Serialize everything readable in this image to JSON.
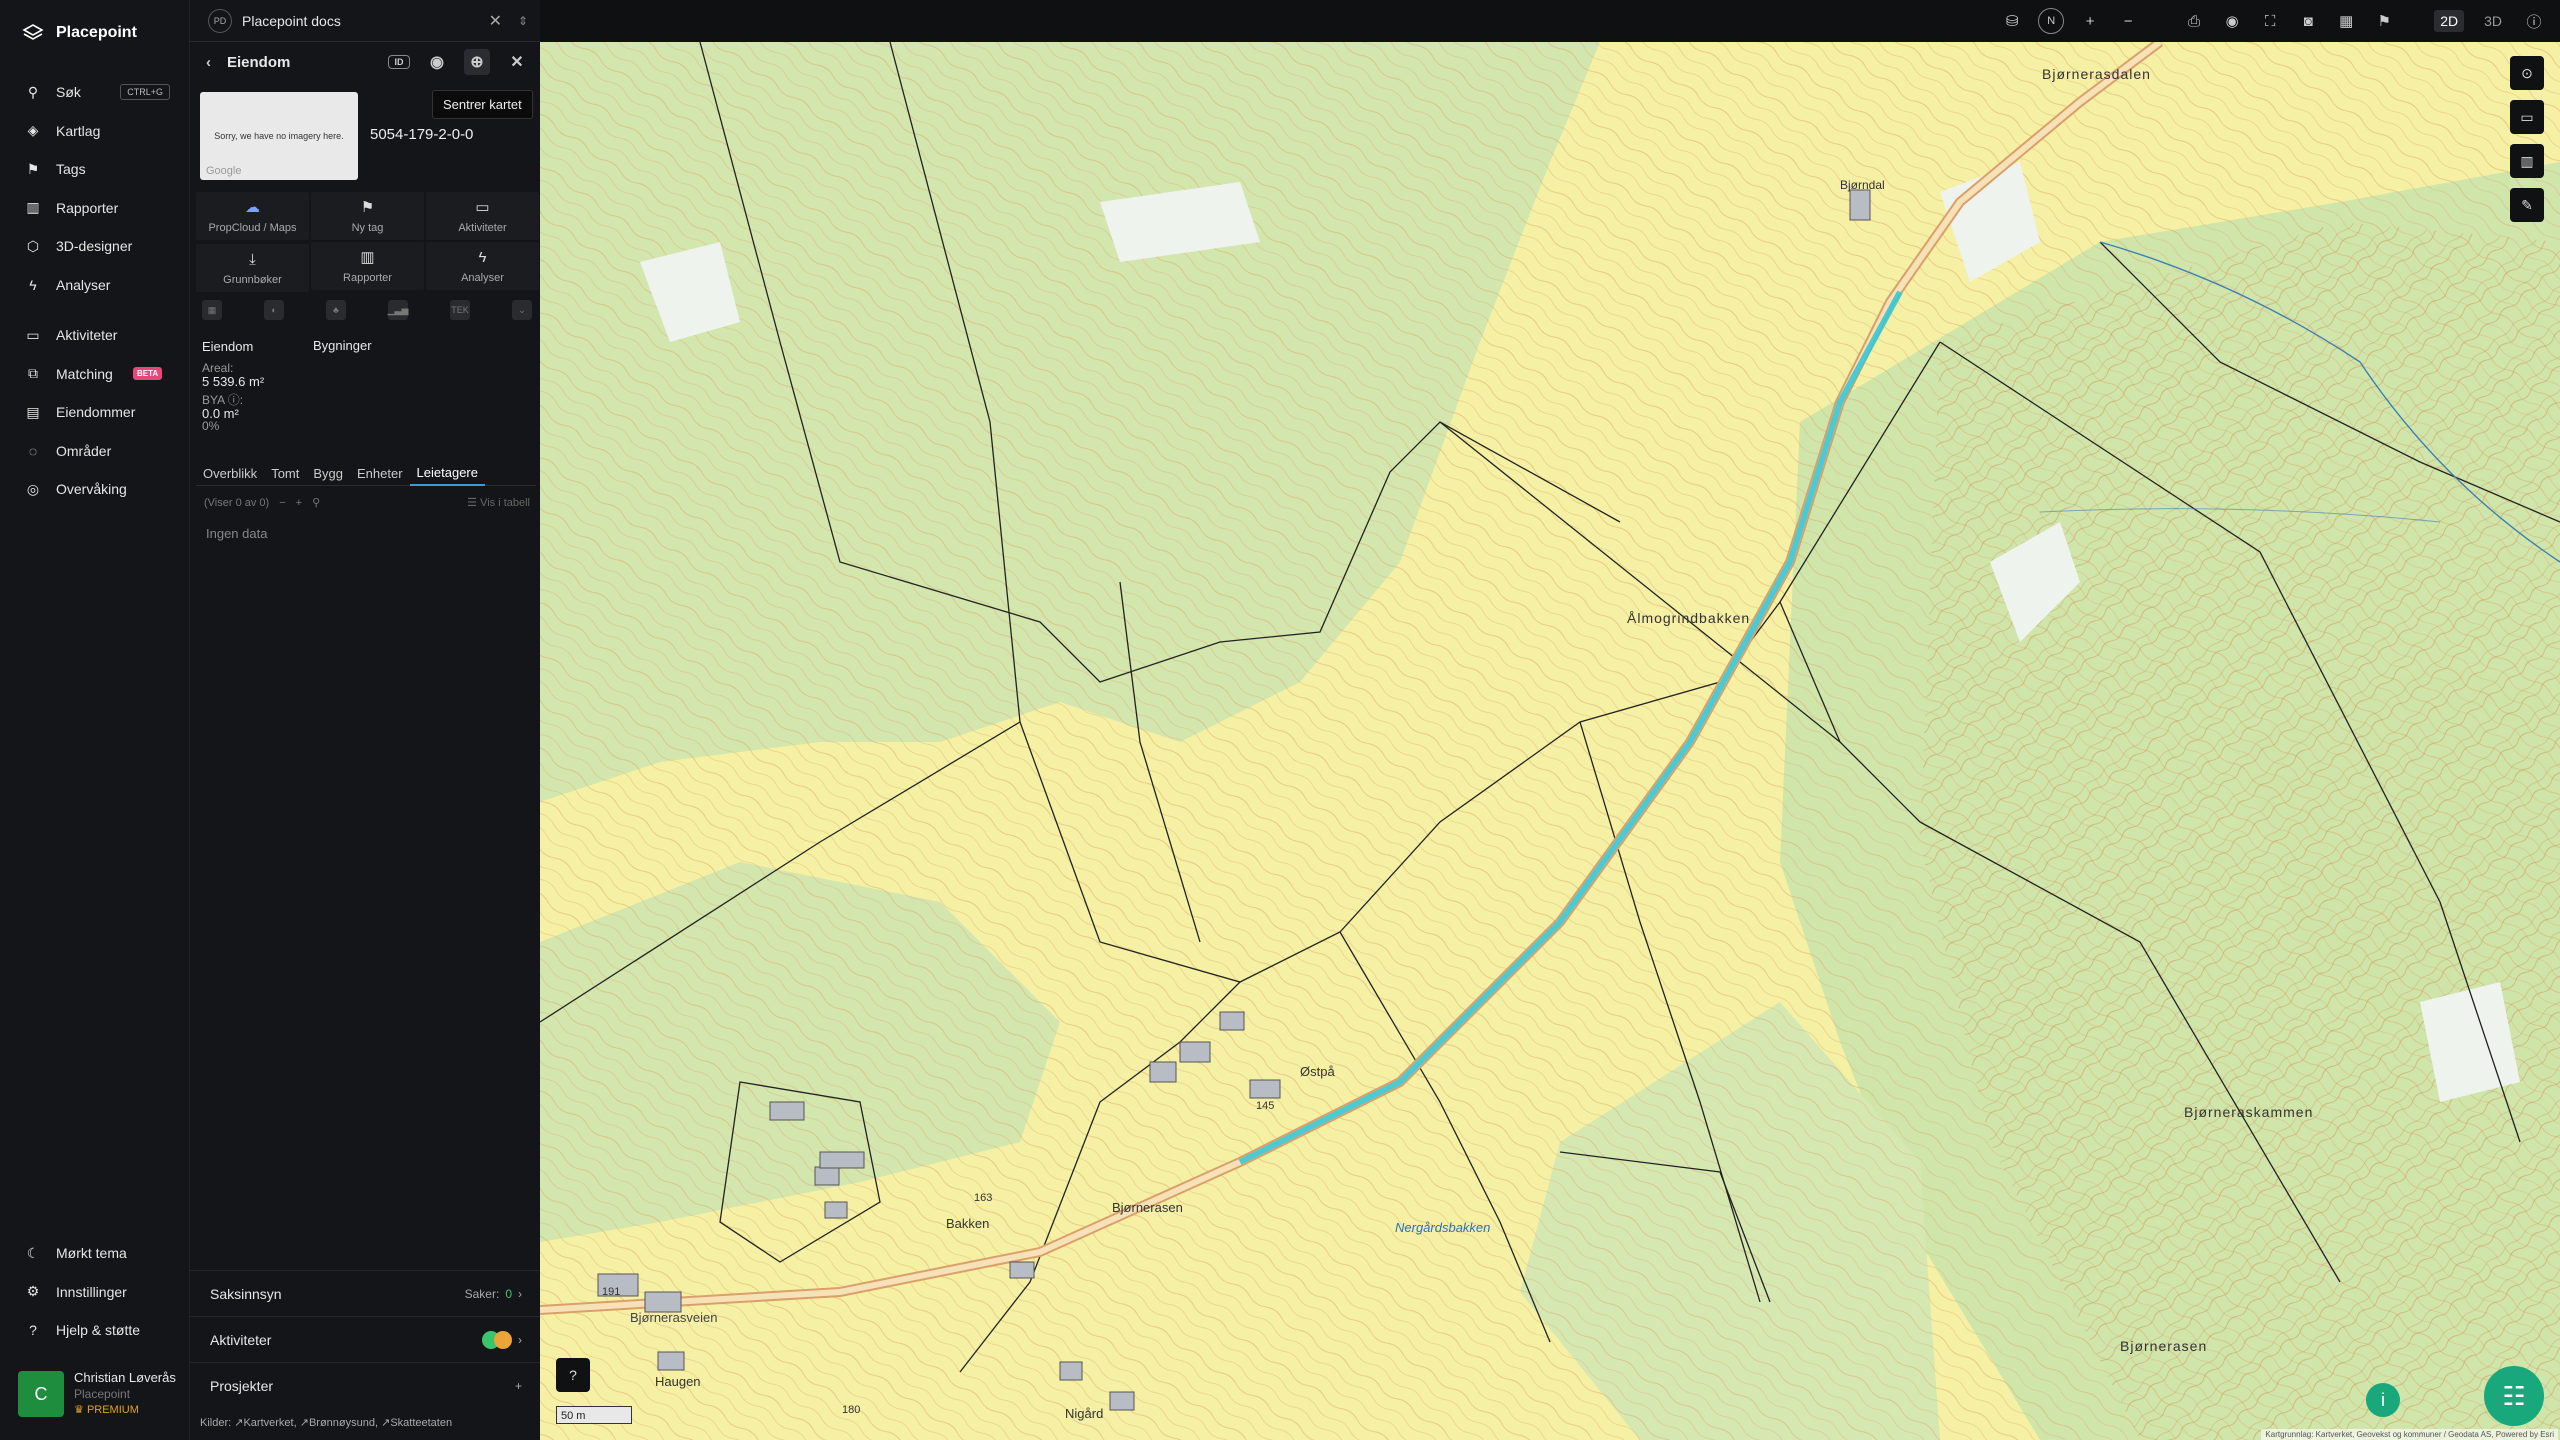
{
  "nav": {
    "brand": "Placepoint",
    "items": [
      {
        "label": "Søk",
        "icon": "search-icon",
        "kbd": "CTRL+G"
      },
      {
        "label": "Kartlag",
        "icon": "layers-icon"
      },
      {
        "label": "Tags",
        "icon": "bookmark-icon"
      },
      {
        "label": "Rapporter",
        "icon": "chart-icon"
      },
      {
        "label": "3D-designer",
        "icon": "cube-icon"
      },
      {
        "label": "Analyser",
        "icon": "bolt-icon"
      }
    ],
    "items2": [
      {
        "label": "Aktiviteter",
        "icon": "chat-icon"
      },
      {
        "label": "Matching",
        "icon": "match-icon",
        "badge": "BETA"
      },
      {
        "label": "Eiendommer",
        "icon": "building-icon"
      },
      {
        "label": "Områder",
        "icon": "area-icon"
      },
      {
        "label": "Overvåking",
        "icon": "monitor-icon"
      }
    ],
    "bottom": [
      {
        "label": "Mørkt tema",
        "icon": "moon-icon"
      },
      {
        "label": "Innstillinger",
        "icon": "gear-icon"
      },
      {
        "label": "Hjelp & støtte",
        "icon": "help-icon"
      }
    ],
    "user": {
      "initial": "C",
      "name": "Christian Løverås",
      "org": "Placepoint",
      "plan": "PREMIUM"
    }
  },
  "panel": {
    "doc_badge": "PD",
    "doc_title": "Placepoint docs",
    "title": "Eiendom",
    "tooltip": "Sentrer kartet",
    "thumb_text": "Sorry, we have no imagery here.",
    "thumb_brand": "Google",
    "property_id": "5054-179-2-0-0",
    "grid": [
      {
        "label": "PropCloud / Maps",
        "icon": "cloud-icon"
      },
      {
        "label": "Ny tag",
        "icon": "bookmark-icon"
      },
      {
        "label": "Aktiviteter",
        "icon": "chat-icon"
      },
      {
        "label": "Grunnbøker",
        "icon": "download-icon"
      },
      {
        "label": "Rapporter",
        "icon": "chart-icon"
      },
      {
        "label": "Analyser",
        "icon": "bolt-icon"
      }
    ],
    "meta_left": "Eiendom",
    "meta_right": "Bygninger",
    "areal_label": "Areal:",
    "areal_value": "5 539.6 m²",
    "bya_label": "BYA ⓘ:",
    "bya_value": "0.0 m²",
    "bya_pct": "0%",
    "tabs": [
      "Overblikk",
      "Tomt",
      "Bygg",
      "Enheter",
      "Leietagere"
    ],
    "active_tab": "Leietagere",
    "list_count": "(Viser 0 av 0)",
    "table_view": "Vis i tabell",
    "no_data": "Ingen data",
    "sections": [
      {
        "label": "Saksinnsyn",
        "right": "Saker:",
        "count": "0"
      },
      {
        "label": "Aktiviteter"
      },
      {
        "label": "Prosjekter"
      }
    ],
    "sources_label": "Kilder:",
    "sources": [
      "Kartverket",
      "Brønnøysund",
      "Skatteetaten"
    ]
  },
  "map": {
    "labels": [
      {
        "text": "Bjørnerasdalen"
      },
      {
        "text": "Bjørndal"
      },
      {
        "text": "Ålmogrindbakken"
      },
      {
        "text": "Østpå"
      },
      {
        "text": "Bakken"
      },
      {
        "text": "Bjørnerasen"
      },
      {
        "text": "Nergårdsbakken"
      },
      {
        "text": "Bjørneraskammen"
      },
      {
        "text": "Bjørnerasen"
      },
      {
        "text": "Bjørnerasveien"
      },
      {
        "text": "Haugen"
      },
      {
        "text": "Nigård"
      },
      {
        "text": "145"
      },
      {
        "text": "163"
      },
      {
        "text": "191"
      },
      {
        "text": "180"
      }
    ],
    "scale": "50 m",
    "credit": "Kartgrunnlag: Kartverket, Geovekst og kommuner / Geodata AS, Powered by Esri",
    "modes": [
      "2D",
      "3D"
    ],
    "compass": "N"
  }
}
